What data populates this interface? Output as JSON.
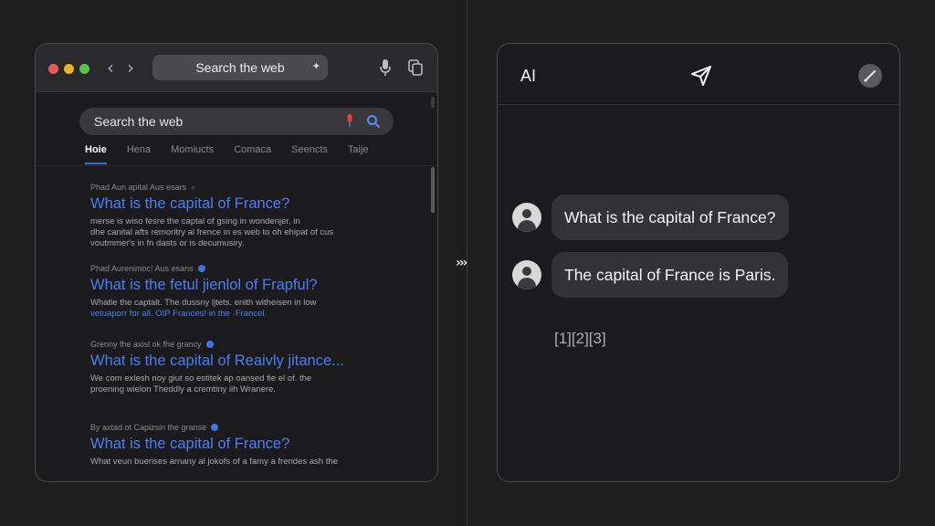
{
  "browser": {
    "address_bar": "Search the web",
    "search_box": "Search the web",
    "tabs": [
      "Hoie",
      "Hena",
      "Momiucts",
      "Comaca",
      "Seencts",
      "Taije"
    ],
    "results": [
      {
        "source": "Phad Aun apital Aus esars",
        "title": "What is the capital of France?",
        "snippet_lines": [
          "merse is wiso fesre the captal of gsing in wondenjer, in",
          "dhe canital afts remoritry al frence in es web to oh ehipat of cus",
          "voutmmer's in fn dasts or is decumusiry."
        ]
      },
      {
        "source": "Phad Aurenimoc! Aus esans",
        "title": "What is the fetul jienlol of Frapful?",
        "snippet_lines": [
          "Whatie the captalt. The dussny ljtets. enith witheisen in low",
          "vetuaporr for all. OIP Frances! in the ·Francel."
        ]
      },
      {
        "source": "Grenny fhe axisl ok fhe grancy",
        "title": "What is the capital of Reaivly jitance...",
        "snippet_lines": [
          "We com exlesh noy giut so estitek ap oansed fie el of. the",
          "proening wielon Theddly a cremtiny iih Wranere."
        ]
      },
      {
        "source": "By axtad ot Capizsin the granse",
        "title": "What is the capital of France?",
        "snippet_lines": [
          "What veun buerises arnany al jokofs of a famy a frendes ash the"
        ]
      }
    ]
  },
  "separator": "›››",
  "chat": {
    "title": "AI",
    "messages": [
      {
        "text": "What is the capital of France?"
      },
      {
        "text": "The capital of France is Paris."
      }
    ],
    "citations": "[1][2][3]"
  },
  "colors": {
    "accent": "#4c7ef3",
    "bubble": "#333335",
    "background": "#1e1e1f"
  },
  "icons": [
    "mic-icon",
    "copy-icon",
    "search-icon",
    "send-icon",
    "edit-icon",
    "user-avatar-icon"
  ]
}
